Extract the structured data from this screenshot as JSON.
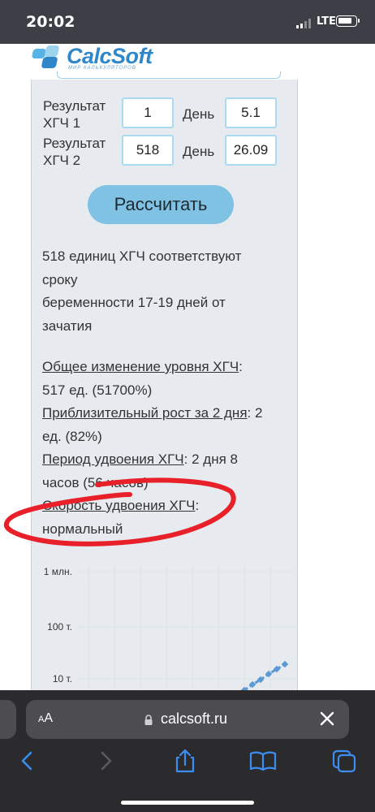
{
  "status": {
    "time": "20:02",
    "network": "LTE"
  },
  "site": {
    "logo_text": "CalcSoft",
    "logo_subtitle": "МИР КАЛЬКУЛЯТОРОВ"
  },
  "form": {
    "row1": {
      "label_line1": "Результат",
      "label_line2": "ХГЧ 1",
      "value": "1",
      "day_label": "День",
      "day_value": "5.1"
    },
    "row2": {
      "label_line1": "Результат",
      "label_line2": "ХГЧ 2",
      "value": "518",
      "day_label": "День",
      "day_value": "26.09"
    },
    "calculate_label": "Рассчитать"
  },
  "result": {
    "line1": "518 единиц ХГЧ соответствуют",
    "line2": "сроку",
    "line3": "беременности 17-19 дней от",
    "line4": "зачатия",
    "total_change_label": "Общее изменение уровня ХГЧ",
    "total_change_value": "517 ед. (51700%)",
    "growth_label": "Приблизительный рост за 2 дня",
    "growth_value_a": "2",
    "growth_value_b": "ед. (82%)",
    "doubling_period_label": "Период удвоения ХГЧ",
    "doubling_period_value_a": "2 дня 8",
    "doubling_period_value_b": "часов (56 часов)",
    "doubling_speed_label": "Скорость удвоения ХГЧ",
    "doubling_speed_value": "нормальный"
  },
  "chart_data": {
    "type": "line",
    "y_scale": "log",
    "y_ticks": [
      "1 млн.",
      "100 т.",
      "10 т."
    ],
    "series": [
      {
        "color": "#5b9bd5",
        "style": "dashed-with-markers"
      }
    ]
  },
  "browser": {
    "text_size_label_small": "A",
    "text_size_label_large": "A",
    "url": "calcsoft.ru"
  },
  "colors": {
    "accent": "#7fc2e3",
    "annotation": "#e8202a",
    "panel": "#e7ebef"
  }
}
